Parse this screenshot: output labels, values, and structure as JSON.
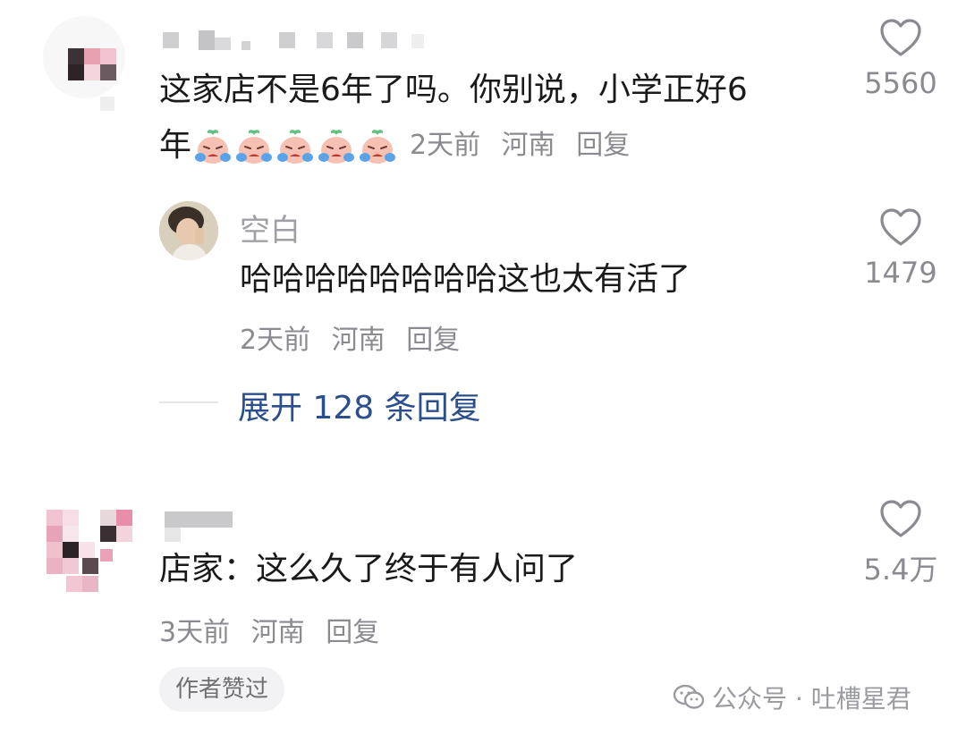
{
  "comments": [
    {
      "text_line1": "这家店不是6年了吗。你别说，小学正好6",
      "text_line2_prefix": "年",
      "time": "2天前",
      "location": "河南",
      "reply_label": "回复",
      "likes": "5560",
      "reply": {
        "username": "空白",
        "text": "哈哈哈哈哈哈哈哈这也太有活了",
        "time": "2天前",
        "location": "河南",
        "reply_label": "回复",
        "likes": "1479"
      },
      "expand_label": "展开 128 条回复"
    },
    {
      "text": "店家：这么久了终于有人问了",
      "time": "3天前",
      "location": "河南",
      "reply_label": "回复",
      "likes": "5.4万",
      "badge": "作者赞过"
    }
  ],
  "watermark": "公众号 · 吐槽星君",
  "colors": {
    "link": "#2b4f8c",
    "meta": "#8a8b91",
    "emoji_face": "#f6c1b3",
    "emoji_tear": "#5aa3e8",
    "emoji_leaf": "#5fbf7f"
  },
  "icons": [
    "heart-icon",
    "crying-emoji-icon",
    "wechat-icon"
  ]
}
